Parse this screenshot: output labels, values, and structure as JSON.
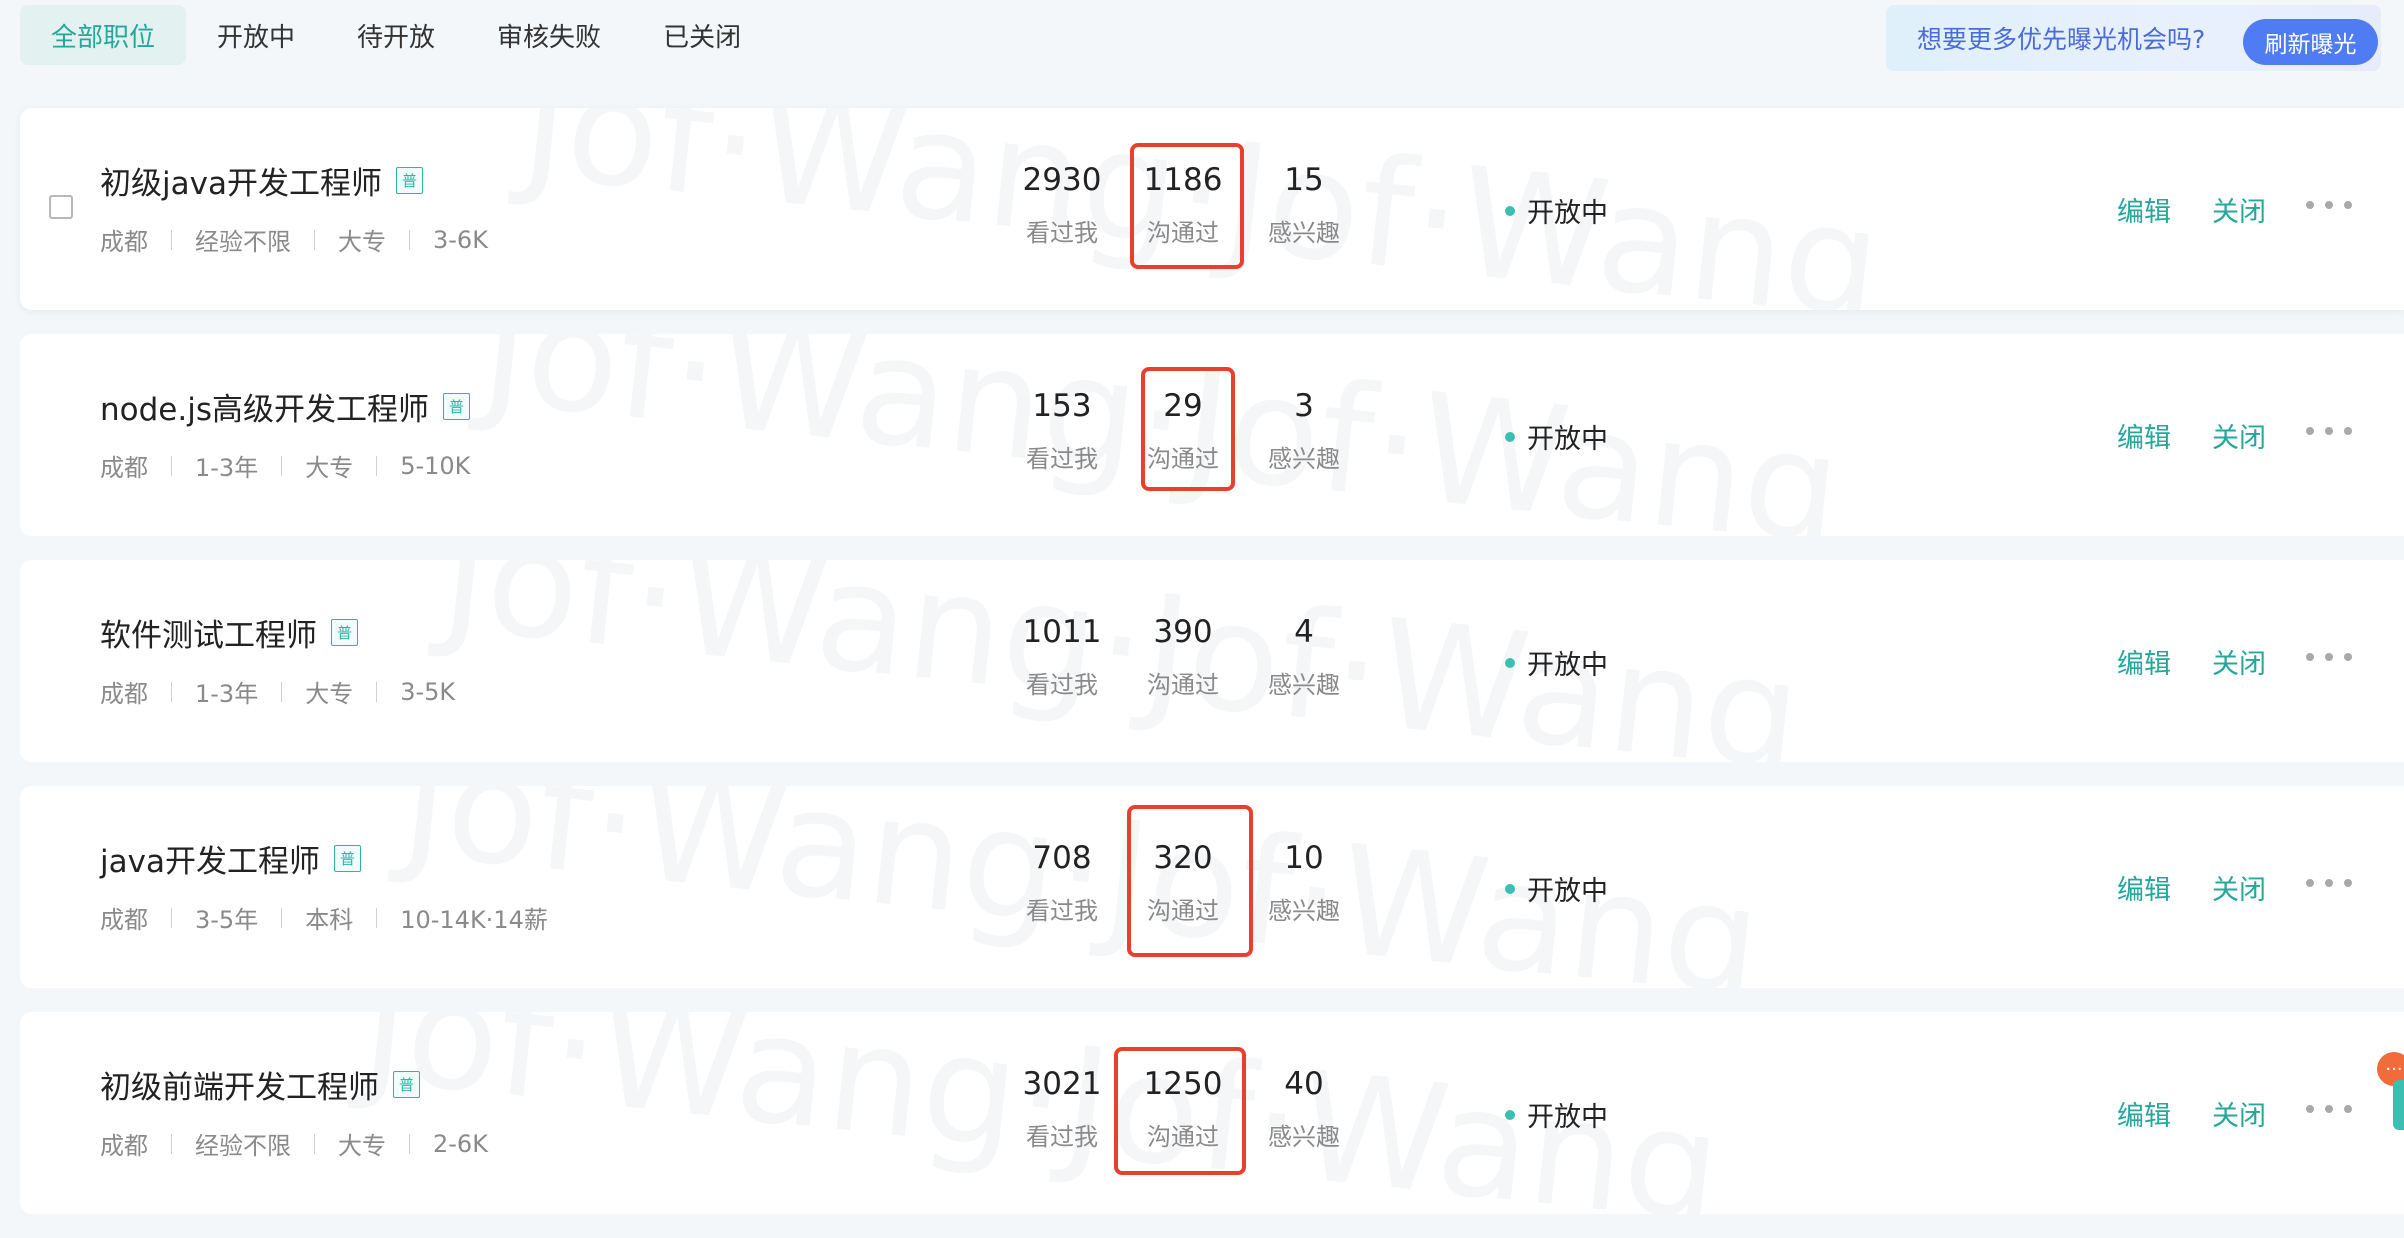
{
  "tabs": [
    {
      "label": "全部职位",
      "active": true
    },
    {
      "label": "开放中",
      "active": false
    },
    {
      "label": "待开放",
      "active": false
    },
    {
      "label": "审核失败",
      "active": false
    },
    {
      "label": "已关闭",
      "active": false
    }
  ],
  "promo": {
    "text": "想要更多优先曝光机会吗?",
    "button_label": "刷新曝光"
  },
  "badge_label": "普",
  "stat_labels": {
    "views": "看过我",
    "chats": "沟通过",
    "interest": "感兴趣"
  },
  "actions": {
    "edit": "编辑",
    "close": "关闭"
  },
  "watermark_text": "Jof·Wang·Jof·Wang",
  "jobs": [
    {
      "title": "初级java开发工程师",
      "city": "成都",
      "experience": "经验不限",
      "education": "大专",
      "salary": "3-6K",
      "views": "2930",
      "chats": "1186",
      "interest": "15",
      "status": "开放中",
      "chats_highlighted": true,
      "has_checkbox": true
    },
    {
      "title": "node.js高级开发工程师",
      "city": "成都",
      "experience": "1-3年",
      "education": "大专",
      "salary": "5-10K",
      "views": "153",
      "chats": "29",
      "interest": "3",
      "status": "开放中",
      "chats_highlighted": true,
      "has_checkbox": false
    },
    {
      "title": "软件测试工程师",
      "city": "成都",
      "experience": "1-3年",
      "education": "大专",
      "salary": "3-5K",
      "views": "1011",
      "chats": "390",
      "interest": "4",
      "status": "开放中",
      "chats_highlighted": false,
      "has_checkbox": false
    },
    {
      "title": "java开发工程师",
      "city": "成都",
      "experience": "3-5年",
      "education": "本科",
      "salary": "10-14K·14薪",
      "views": "708",
      "chats": "320",
      "interest": "10",
      "status": "开放中",
      "chats_highlighted": true,
      "has_checkbox": false
    },
    {
      "title": "初级前端开发工程师",
      "city": "成都",
      "experience": "经验不限",
      "education": "大专",
      "salary": "2-6K",
      "views": "3021",
      "chats": "1250",
      "interest": "40",
      "status": "开放中",
      "chats_highlighted": true,
      "has_checkbox": false
    }
  ],
  "colors": {
    "accent": "#25a79c",
    "highlight_box": "#e8402d",
    "promo_button": "#4f7cf2",
    "status_dot": "#3bbfb1"
  },
  "icons": {
    "more": "more-horizontal-icon",
    "chat_widget": "chat-bubble-icon"
  }
}
